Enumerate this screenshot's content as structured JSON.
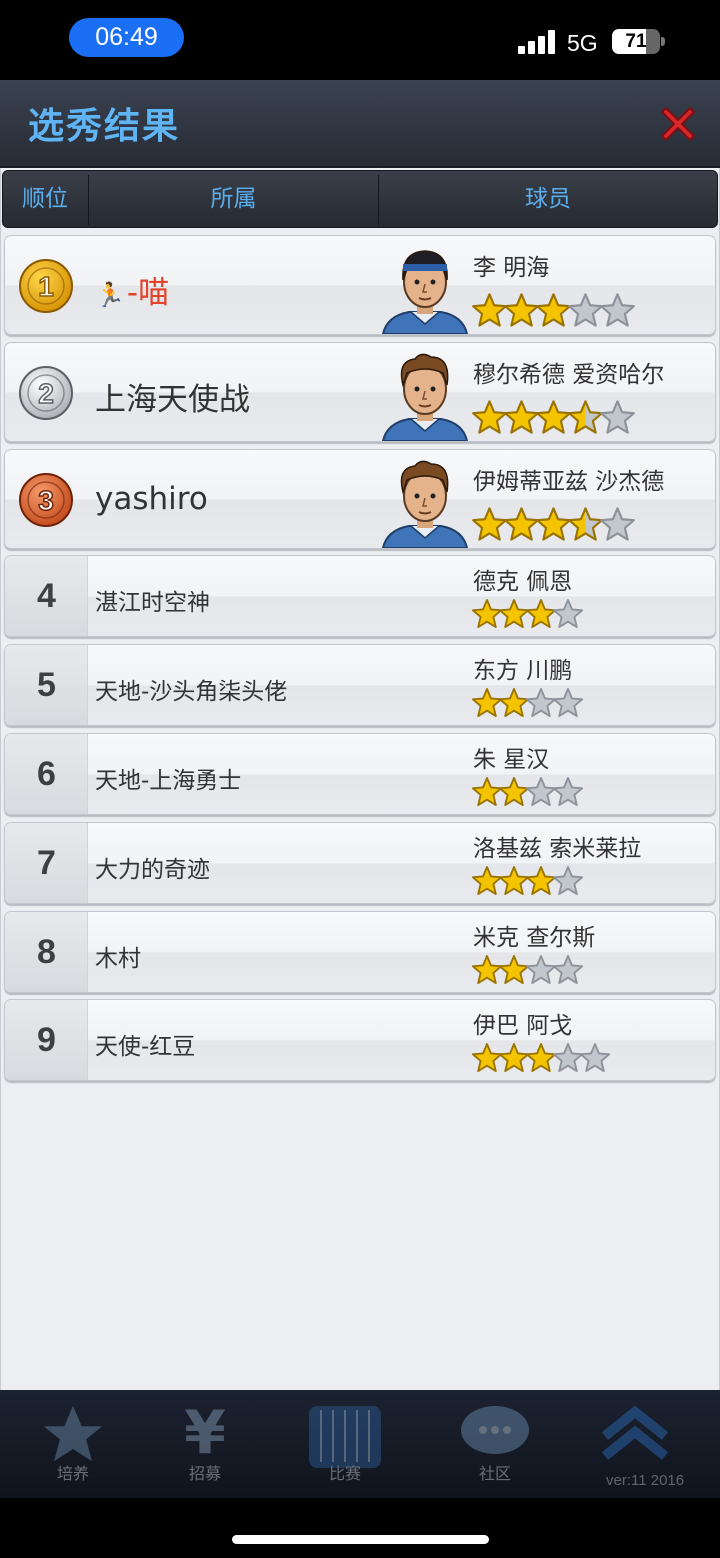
{
  "status_bar": {
    "time": "06:49",
    "network": "5G",
    "battery_level": 71,
    "battery_text": "71"
  },
  "header": {
    "title": "选秀结果"
  },
  "columns": {
    "rank": "顺位",
    "team": "所属",
    "player": "球员"
  },
  "colors": {
    "accent_blue": "#5fb4f4",
    "close_red": "#d8262a",
    "star_gold": "#f5c400",
    "star_empty": "#b8bcc4",
    "first_team_red": "#e3432b"
  },
  "picks": [
    {
      "rank": "1",
      "team": "-喵",
      "team_icon": "runner-emoji-icon",
      "player": "李 明海",
      "stars": 3,
      "star_total": 5,
      "medal": "gold-medal-icon"
    },
    {
      "rank": "2",
      "team": "上海天使战",
      "player": "穆尔希德 爱资哈尔",
      "stars": 3.5,
      "star_total": 5,
      "medal": "silver-medal-icon"
    },
    {
      "rank": "3",
      "team": "yashiro",
      "player": "伊姆蒂亚兹 沙杰德",
      "stars": 3.5,
      "star_total": 5,
      "medal": "bronze-medal-icon"
    },
    {
      "rank": "4",
      "team": "湛江时空神",
      "player": "德克 佩恩",
      "stars": 3,
      "star_total": 4
    },
    {
      "rank": "5",
      "team": "天地-沙头角柒头佬",
      "player": "东方 川鹏",
      "stars": 2,
      "star_total": 4
    },
    {
      "rank": "6",
      "team": "天地-上海勇士",
      "player": "朱 星汉",
      "stars": 2,
      "star_total": 4
    },
    {
      "rank": "7",
      "team": "大力的奇迹",
      "player": "洛基兹 索米莱拉",
      "stars": 3,
      "star_total": 4
    },
    {
      "rank": "8",
      "team": "木村",
      "player": "米克 查尔斯",
      "stars": 2,
      "star_total": 4
    },
    {
      "rank": "9",
      "team": "天使-红豆",
      "player": "伊巴 阿戈",
      "stars": 3,
      "star_total": 5
    }
  ],
  "bottom_nav": {
    "items": [
      {
        "label": "培养",
        "icon": "star-icon"
      },
      {
        "label": "招募",
        "icon": "yen-icon"
      },
      {
        "label": "比赛",
        "icon": "court-icon"
      },
      {
        "label": "社区",
        "icon": "chat-icon"
      },
      {
        "label": "",
        "icon": "chevron-up-icon"
      }
    ],
    "version": "ver:11  2016"
  }
}
